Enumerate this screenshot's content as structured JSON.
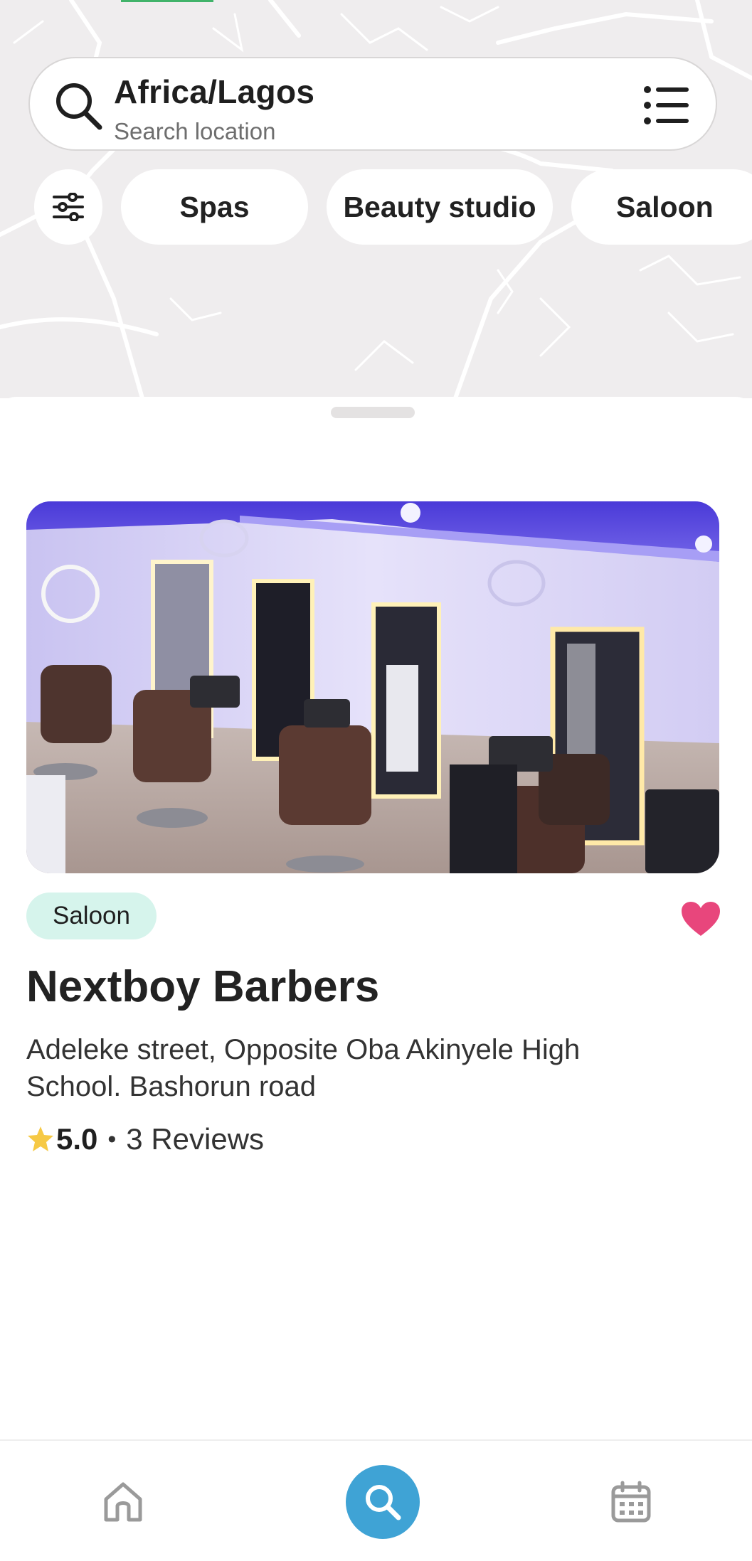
{
  "search": {
    "location": "Africa/Lagos",
    "placeholder": "Search location"
  },
  "filters": {
    "chips": [
      "Spas",
      "Beauty studio",
      "Saloon"
    ]
  },
  "listing": {
    "category": "Saloon",
    "name": "Nextboy Barbers",
    "address": "Adeleke street, Opposite Oba Akinyele High School. Bashorun road",
    "rating": "5.0",
    "separator": "•",
    "reviews": "3 Reviews",
    "favorited": true
  },
  "nav": {
    "items": [
      "home-icon",
      "search-icon",
      "calendar-icon"
    ],
    "active": "search-icon"
  },
  "colors": {
    "accent": "#3fa3d5",
    "badge_bg": "#d6f4ec",
    "heart": "#e8467c",
    "star": "#f6c945",
    "map_bg": "#efedee"
  }
}
